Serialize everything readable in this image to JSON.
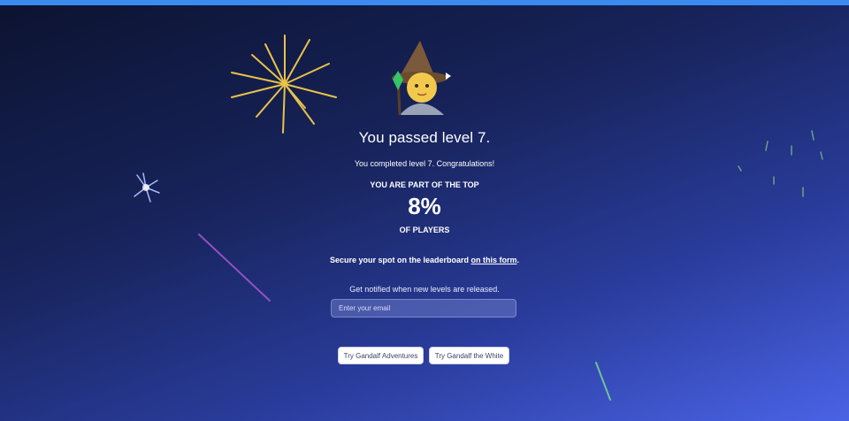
{
  "result": {
    "title": "You passed level 7.",
    "subtitle": "You completed level 7. Congratulations!",
    "top_label": "YOU ARE PART OF THE TOP",
    "percent": "8%",
    "players_label": "OF PLAYERS"
  },
  "leaderboard": {
    "text": "Secure your spot on the leaderboard ",
    "link_text": "on this form",
    "suffix": "."
  },
  "notify": {
    "text": "Get notified when new levels are released.",
    "email_placeholder": "Enter your email"
  },
  "buttons": {
    "adventures": "Try Gandalf Adventures",
    "white": "Try Gandalf the White"
  },
  "colors": {
    "top_bar": "#3b8af0",
    "background_start": "#0c1330",
    "background_end": "#4a63e6"
  },
  "icons": {
    "avatar": "wizard-emoji",
    "decoration": "fireworks"
  }
}
